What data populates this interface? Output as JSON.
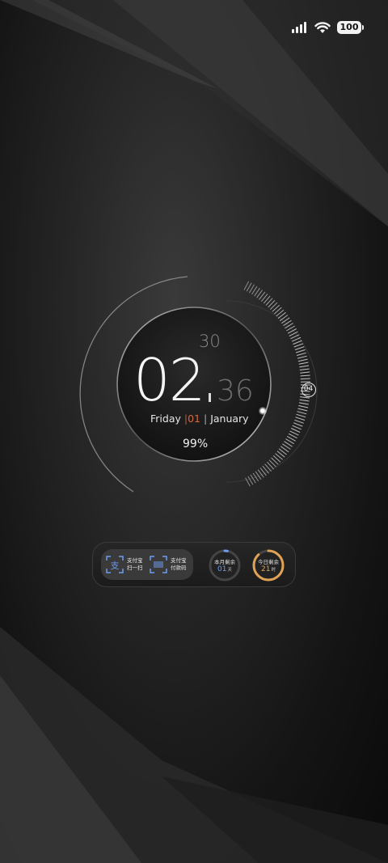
{
  "status_bar": {
    "battery_level": "100",
    "wifi_icon": "wifi-icon",
    "signal_icon": "signal-icon"
  },
  "clock": {
    "hour": "02",
    "minute": "36",
    "minute_small": "30",
    "hour_marker": "04",
    "weekday": "Friday",
    "day_sep_left": "|",
    "day": "01",
    "day_sep_right": "|",
    "month": "January",
    "battery_percent": "99%"
  },
  "dock": {
    "alipay_scan": {
      "line1": "支付宝",
      "line2": "扫一扫",
      "icon": "scan-icon"
    },
    "alipay_pay": {
      "line1": "支付宝",
      "line2": "付款码",
      "icon": "barcode-icon"
    },
    "month_remaining": {
      "label": "本月剩余",
      "value": "01",
      "unit": "天",
      "color": "#6e9cf0",
      "progress": 0.03
    },
    "today_remaining": {
      "label": "今日剩余",
      "value": "21",
      "unit": "时",
      "color": "#e0a355",
      "progress": 0.88
    }
  },
  "colors": {
    "accent_orange": "#d9673f",
    "ring_blue": "#6e9cf0",
    "ring_gold": "#e0a355"
  }
}
